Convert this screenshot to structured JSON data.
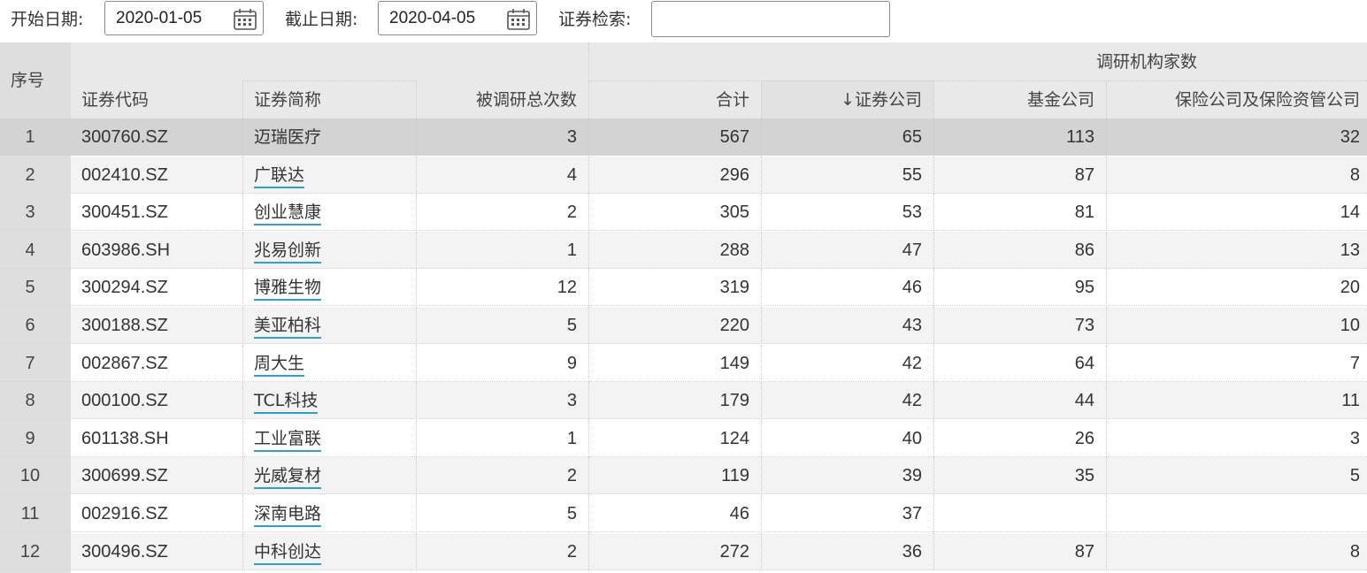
{
  "filters": {
    "start_label": "开始日期:",
    "start_value": "2020-01-05",
    "end_label": "截止日期:",
    "end_value": "2020-04-05",
    "search_label": "证券检索:",
    "search_value": "",
    "icons": {
      "calendar": "calendar-icon"
    }
  },
  "table": {
    "headers": {
      "index": "序号",
      "code": "证券代码",
      "name": "证券简称",
      "times": "被调研总次数",
      "group": "调研机构家数",
      "total": "合计",
      "securities": "↓证券公司",
      "fund": "基金公司",
      "insurance": "保险公司及保险资管公司"
    },
    "rows": [
      {
        "idx": "1",
        "code": "300760.SZ",
        "name": "迈瑞医疗",
        "times": "3",
        "total": "567",
        "sec": "65",
        "fund": "113",
        "ins": "32"
      },
      {
        "idx": "2",
        "code": "002410.SZ",
        "name": "广联达",
        "times": "4",
        "total": "296",
        "sec": "55",
        "fund": "87",
        "ins": "8"
      },
      {
        "idx": "3",
        "code": "300451.SZ",
        "name": "创业慧康",
        "times": "2",
        "total": "305",
        "sec": "53",
        "fund": "81",
        "ins": "14"
      },
      {
        "idx": "4",
        "code": "603986.SH",
        "name": "兆易创新",
        "times": "1",
        "total": "288",
        "sec": "47",
        "fund": "86",
        "ins": "13"
      },
      {
        "idx": "5",
        "code": "300294.SZ",
        "name": "博雅生物",
        "times": "12",
        "total": "319",
        "sec": "46",
        "fund": "95",
        "ins": "20"
      },
      {
        "idx": "6",
        "code": "300188.SZ",
        "name": "美亚柏科",
        "times": "5",
        "total": "220",
        "sec": "43",
        "fund": "73",
        "ins": "10"
      },
      {
        "idx": "7",
        "code": "002867.SZ",
        "name": "周大生",
        "times": "9",
        "total": "149",
        "sec": "42",
        "fund": "64",
        "ins": "7"
      },
      {
        "idx": "8",
        "code": "000100.SZ",
        "name": "TCL科技",
        "times": "3",
        "total": "179",
        "sec": "42",
        "fund": "44",
        "ins": "11"
      },
      {
        "idx": "9",
        "code": "601138.SH",
        "name": "工业富联",
        "times": "1",
        "total": "124",
        "sec": "40",
        "fund": "26",
        "ins": "3"
      },
      {
        "idx": "10",
        "code": "300699.SZ",
        "name": "光威复材",
        "times": "2",
        "total": "119",
        "sec": "39",
        "fund": "35",
        "ins": "5"
      },
      {
        "idx": "11",
        "code": "002916.SZ",
        "name": "深南电路",
        "times": "5",
        "total": "46",
        "sec": "37",
        "fund": "",
        "ins": ""
      },
      {
        "idx": "12",
        "code": "300496.SZ",
        "name": "中科创达",
        "times": "2",
        "total": "272",
        "sec": "36",
        "fund": "87",
        "ins": "8"
      }
    ]
  },
  "colors": {
    "selected_row": "#d3d3d3",
    "odd_row": "#ffffff",
    "even_row": "#f3f3f3",
    "index_column": "#dedede",
    "header_band": "#e9e9e9",
    "link_underline": "#2ba0d4"
  }
}
